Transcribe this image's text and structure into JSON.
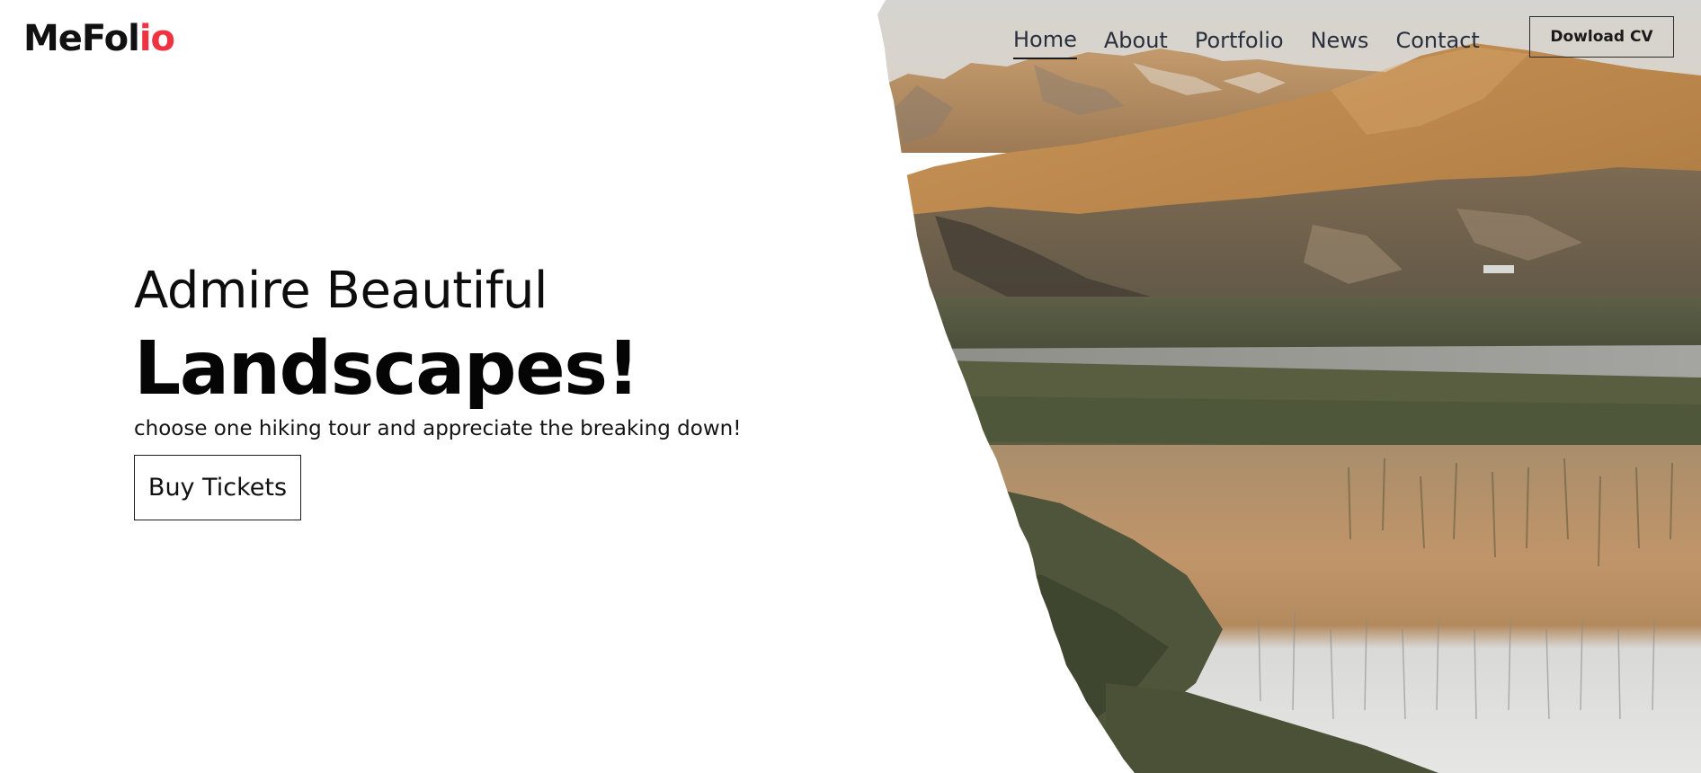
{
  "logo": {
    "main": "MeFol",
    "accent": "io"
  },
  "nav": {
    "items": [
      {
        "label": "Home",
        "active": true
      },
      {
        "label": "About",
        "active": false
      },
      {
        "label": "Portfolio",
        "active": false
      },
      {
        "label": "News",
        "active": false
      },
      {
        "label": "Contact",
        "active": false
      }
    ],
    "cv_button": "Dowload CV"
  },
  "hero": {
    "title_line1": "Admire Beautiful",
    "title_line2": "Landscapes!",
    "subtitle": "choose one hiking tour and appreciate the breaking down!",
    "cta_label": "Buy Tickets"
  },
  "colors": {
    "accent": "#ef3340",
    "text": "#111111",
    "background": "#ffffff"
  }
}
